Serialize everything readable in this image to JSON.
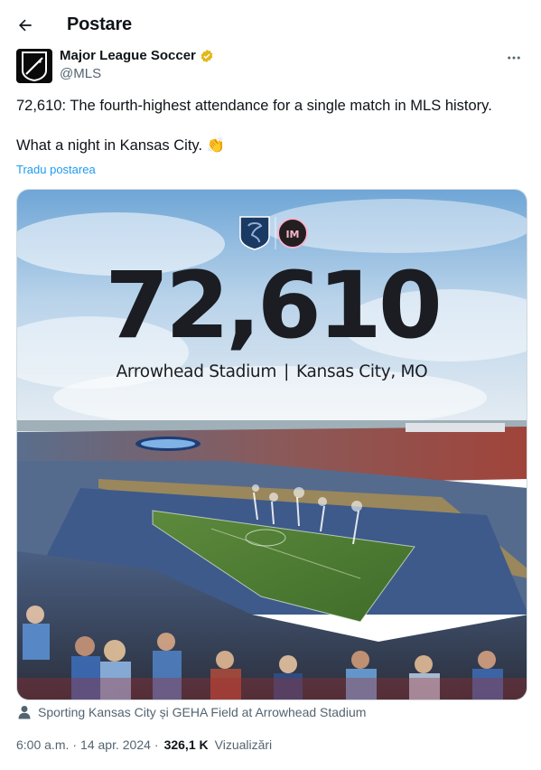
{
  "header": {
    "title": "Postare"
  },
  "author": {
    "name": "Major League Soccer",
    "handle": "@MLS",
    "avatar_text": "MLS",
    "verified_color": "#e2b719"
  },
  "tweet": {
    "line1": "72,610: The fourth-highest attendance for a single match in MLS history.",
    "line2": "What a night in Kansas City. 👏",
    "translate_label": "Tradu postarea"
  },
  "media": {
    "attendance": "72,610",
    "stadium": "Arrowhead Stadium",
    "separator": "|",
    "city": "Kansas City, MO",
    "caption": "Sporting Kansas City și GEHA Field at Arrowhead Stadium"
  },
  "meta": {
    "time": "6:00 a.m.",
    "dot1": "·",
    "date": "14 apr. 2024",
    "dot2": "·",
    "views_count": "326,1 K",
    "views_label": "Vizualizări"
  },
  "colors": {
    "accent": "#1d9bf0",
    "secondary_text": "#536471",
    "primary_text": "#0f1419"
  }
}
